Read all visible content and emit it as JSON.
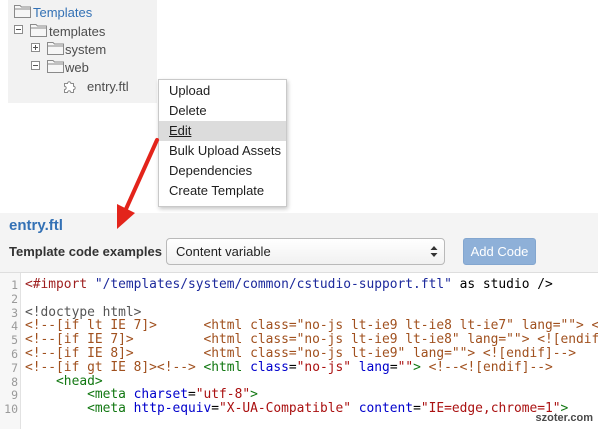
{
  "tree": {
    "root_label": "Templates",
    "items": [
      {
        "label": "templates",
        "expander_icon": "minus-box-icon",
        "icon": "folder-icon"
      },
      {
        "label": "system",
        "expander_icon": "plus-box-icon",
        "icon": "folder-icon"
      },
      {
        "label": "web",
        "expander_icon": "minus-box-icon",
        "icon": "folder-icon"
      },
      {
        "label": "entry.ftl",
        "icon": "puzzle-piece-icon"
      }
    ]
  },
  "context_menu": {
    "items": [
      {
        "label": "Upload"
      },
      {
        "label": "Delete"
      },
      {
        "label": "Edit",
        "highlighted": true
      },
      {
        "label": "Bulk Upload Assets"
      },
      {
        "label": "Dependencies"
      },
      {
        "label": "Create Template"
      }
    ]
  },
  "editor": {
    "file_title": "entry.ftl",
    "examples_label": "Template code examples",
    "examples_select": {
      "selected": "Content variable"
    },
    "add_code_label": "Add Code",
    "lines": [
      {
        "n": "1",
        "tokens": [
          {
            "type": "ftl",
            "text": "<#import"
          },
          {
            "type": "plain",
            "text": " "
          },
          {
            "type": "ftlstr",
            "text": "\"/templates/system/common/cstudio-support.ftl\""
          },
          {
            "type": "plain",
            "text": " as studio />"
          }
        ]
      },
      {
        "n": "2",
        "tokens": []
      },
      {
        "n": "3",
        "tokens": [
          {
            "type": "meta",
            "text": "<!doctype html>"
          }
        ]
      },
      {
        "n": "4",
        "tokens": [
          {
            "type": "com",
            "text": "<!--[if lt IE 7]>      <html class=\"no-js lt-ie9 lt-ie8 lt-ie7\" lang=\"\"> <"
          }
        ]
      },
      {
        "n": "5",
        "tokens": [
          {
            "type": "com",
            "text": "<!--[if IE 7]>         <html class=\"no-js lt-ie9 lt-ie8\" lang=\"\"> <![endif"
          }
        ]
      },
      {
        "n": "6",
        "tokens": [
          {
            "type": "com",
            "text": "<!--[if IE 8]>         <html class=\"no-js lt-ie9\" lang=\"\"> <![endif]-->"
          }
        ]
      },
      {
        "n": "7",
        "tokens": [
          {
            "type": "com",
            "text": "<!--[if gt IE 8]><!-->"
          },
          {
            "type": "plain",
            "text": " "
          },
          {
            "type": "tag",
            "text": "<html"
          },
          {
            "type": "attr",
            "text": " class"
          },
          {
            "type": "plain",
            "text": "="
          },
          {
            "type": "val",
            "text": "\"no-js\""
          },
          {
            "type": "attr",
            "text": " lang"
          },
          {
            "type": "plain",
            "text": "="
          },
          {
            "type": "val",
            "text": "\"\""
          },
          {
            "type": "tag",
            "text": ">"
          },
          {
            "type": "plain",
            "text": " "
          },
          {
            "type": "com",
            "text": "<!--<![endif]-->"
          }
        ]
      },
      {
        "n": "8",
        "tokens": [
          {
            "type": "plain",
            "text": "    "
          },
          {
            "type": "tag",
            "text": "<head>"
          }
        ]
      },
      {
        "n": "9",
        "tokens": [
          {
            "type": "plain",
            "text": "        "
          },
          {
            "type": "tag",
            "text": "<meta"
          },
          {
            "type": "attr",
            "text": " charset"
          },
          {
            "type": "plain",
            "text": "="
          },
          {
            "type": "val",
            "text": "\"utf-8\""
          },
          {
            "type": "tag",
            "text": ">"
          }
        ]
      },
      {
        "n": "10",
        "tokens": [
          {
            "type": "plain",
            "text": "        "
          },
          {
            "type": "tag",
            "text": "<meta"
          },
          {
            "type": "attr",
            "text": " http-equiv"
          },
          {
            "type": "plain",
            "text": "="
          },
          {
            "type": "val",
            "text": "\"X-UA-Compatible\""
          },
          {
            "type": "attr",
            "text": " content"
          },
          {
            "type": "plain",
            "text": "="
          },
          {
            "type": "val",
            "text": "\"IE=edge,chrome=1\""
          },
          {
            "type": "tag",
            "text": ">"
          }
        ]
      }
    ]
  },
  "icons": {
    "root": "folder-icon",
    "collapse": "minus-box-icon",
    "expand": "plus-box-icon",
    "template_file": "puzzle-piece-icon",
    "select_arrows": "up-down-chevron-icon"
  },
  "colors": {
    "link": "#3371b5",
    "arrow": "#e3241b",
    "button": "#8eb0d8",
    "tree_panel": "#f2f2f2",
    "header": "#f4f4f4",
    "menu_highlight": "#dcdcdc",
    "syntax": {
      "ftl": "#9e1e1e",
      "ftlstr": "#1d2a9c",
      "plain": "#000000",
      "meta": "#555555",
      "com": "#a0501e",
      "tag": "#117711",
      "attr": "#0000cc",
      "val": "#aa1111"
    }
  },
  "watermark": "szoter.com"
}
